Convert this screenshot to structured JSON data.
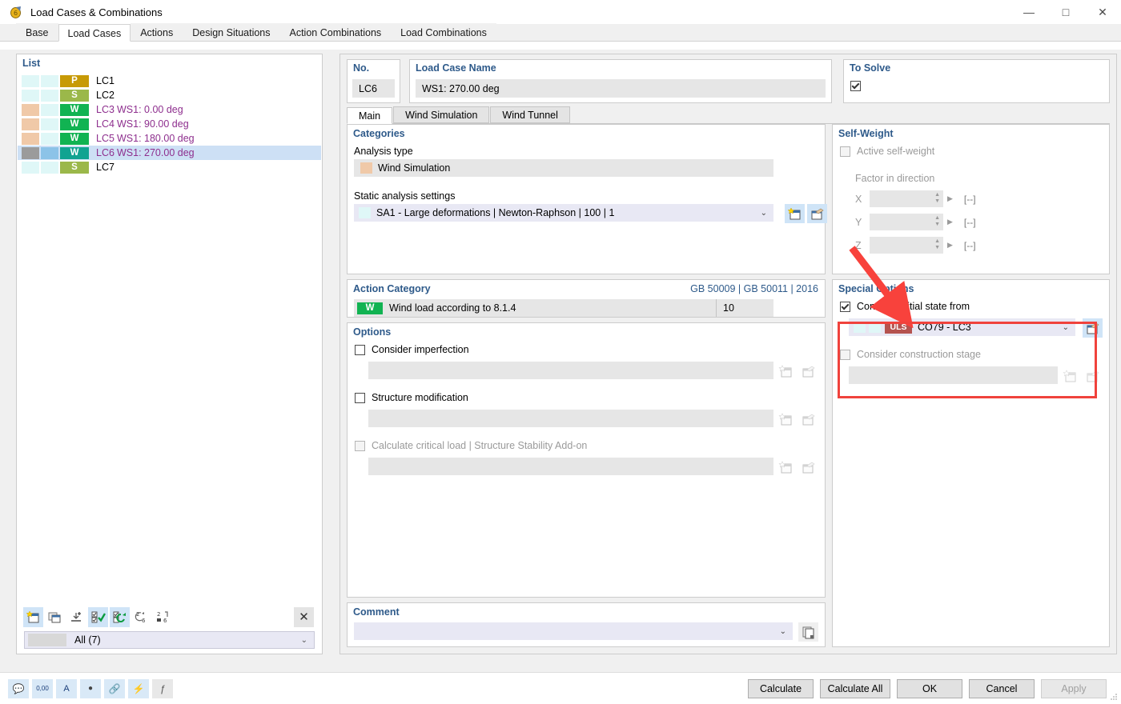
{
  "window": {
    "title": "Load Cases & Combinations",
    "icon": "app-icon",
    "minimize": "—",
    "maximize": "□",
    "close": "✕"
  },
  "tabs": [
    {
      "label": "Base",
      "active": false
    },
    {
      "label": "Load Cases",
      "active": true
    },
    {
      "label": "Actions",
      "active": false
    },
    {
      "label": "Design Situations",
      "active": false
    },
    {
      "label": "Action Combinations",
      "active": false
    },
    {
      "label": "Load Combinations",
      "active": false
    }
  ],
  "list": {
    "title": "List",
    "rows": [
      {
        "sw1": "#dff7f7",
        "sw2": "#dff7f7",
        "badge": "P",
        "badge_color": "#c79a06",
        "no": "LC1",
        "desc": "",
        "selected": false
      },
      {
        "sw1": "#dff7f7",
        "sw2": "#dff7f7",
        "badge": "S",
        "badge_color": "#9bb84a",
        "no": "LC2",
        "desc": "",
        "selected": false
      },
      {
        "sw1": "#f0c9a8",
        "sw2": "#dff7f7",
        "badge": "W",
        "badge_color": "#11b352",
        "no": "LC3",
        "desc": "WS1: 0.00 deg",
        "selected": false
      },
      {
        "sw1": "#f0c9a8",
        "sw2": "#dff7f7",
        "badge": "W",
        "badge_color": "#11b352",
        "no": "LC4",
        "desc": "WS1: 90.00 deg",
        "selected": false
      },
      {
        "sw1": "#f0c9a8",
        "sw2": "#dff7f7",
        "badge": "W",
        "badge_color": "#11b352",
        "no": "LC5",
        "desc": "WS1: 180.00 deg",
        "selected": false
      },
      {
        "sw1": "#9b9b9b",
        "sw2": "#8cc3e8",
        "badge": "W",
        "badge_color": "#11a391",
        "no": "LC6",
        "desc": "WS1: 270.00 deg",
        "selected": true
      },
      {
        "sw1": "#dff7f7",
        "sw2": "#dff7f7",
        "badge": "S",
        "badge_color": "#9bb84a",
        "no": "LC7",
        "desc": "",
        "selected": false
      }
    ],
    "toolbar": [
      {
        "name": "new-load-case-button",
        "highlight": true
      },
      {
        "name": "copy-load-case-button",
        "highlight": false
      },
      {
        "name": "import-load-case-button",
        "highlight": false
      },
      {
        "name": "select-all-button",
        "highlight": true
      },
      {
        "name": "invert-selection-button",
        "highlight": true
      },
      {
        "name": "renumber-button",
        "highlight": false
      },
      {
        "name": "sort-button",
        "highlight": false
      }
    ],
    "close_icon": "✕",
    "filter": {
      "label": "All (7)",
      "caret": "⌄"
    }
  },
  "header": {
    "no": {
      "title": "No.",
      "value": "LC6"
    },
    "name": {
      "title": "Load Case Name",
      "value": "WS1: 270.00 deg"
    },
    "to_solve": {
      "title": "To Solve",
      "checked": true
    }
  },
  "inner_tabs": [
    {
      "label": "Main",
      "active": true
    },
    {
      "label": "Wind Simulation",
      "active": false
    },
    {
      "label": "Wind Tunnel",
      "active": false
    }
  ],
  "categories": {
    "title": "Categories",
    "analysis_type_label": "Analysis type",
    "analysis_type_value": "Wind Simulation",
    "analysis_type_color": "#f0c9a8",
    "static_settings_label": "Static analysis settings",
    "static_settings_value": "SA1 - Large deformations | Newton-Raphson | 100 | 1",
    "static_settings_color": "#dff7f7",
    "caret": "⌄",
    "new_icon": "new-icon",
    "edit_icon": "edit-icon"
  },
  "action_category": {
    "title": "Action Category",
    "standard": "GB 50009 | GB 50011 | 2016",
    "badge": "W",
    "badge_color": "#11b352",
    "value": "Wind load according to 8.1.4",
    "number": "10"
  },
  "options": {
    "title": "Options",
    "items": [
      {
        "label": "Consider imperfection",
        "checked": false,
        "disabled": false,
        "value": ""
      },
      {
        "label": "Structure modification",
        "checked": false,
        "disabled": false,
        "value": ""
      },
      {
        "label": "Calculate critical load | Structure Stability Add-on",
        "checked": false,
        "disabled": true,
        "value": ""
      }
    ]
  },
  "comment": {
    "title": "Comment",
    "value": "",
    "caret": "⌄",
    "copy_icon": "copy-icon"
  },
  "self_weight": {
    "title": "Self-Weight",
    "active_label": "Active self-weight",
    "active_checked": false,
    "factor_label": "Factor in direction",
    "axes": [
      {
        "label": "X",
        "value": "",
        "unit": "[--]"
      },
      {
        "label": "Y",
        "value": "",
        "unit": "[--]"
      },
      {
        "label": "Z",
        "value": "",
        "unit": "[--]"
      }
    ]
  },
  "special_options": {
    "title": "Special Options",
    "initial_state": {
      "label": "Consider initial state from",
      "checked": true,
      "sw1": "#dff7f7",
      "sw2": "#dff7f7",
      "badge": "ULS",
      "badge_color": "#b5534f",
      "value": "CO79 - LC3",
      "caret": "⌄",
      "edit_icon": "edit-icon"
    },
    "construction_stage": {
      "label": "Consider construction stage",
      "checked": false,
      "disabled": true,
      "value": ""
    },
    "highlight_color": "#f0423c"
  },
  "annotation": {
    "arrow_color": "#f8423c",
    "name": "red-arrow-annotation"
  },
  "status_bar": {
    "icons": [
      {
        "name": "info-icon",
        "glyph": "💬",
        "style": "blue"
      },
      {
        "name": "numeric-icon",
        "glyph": "0,00",
        "style": "blue"
      },
      {
        "name": "color-label-icon",
        "glyph": "A",
        "style": "blue"
      },
      {
        "name": "point-icon",
        "glyph": "●",
        "style": "blue"
      },
      {
        "name": "link-icon",
        "glyph": "🔗",
        "style": "blue"
      },
      {
        "name": "snap-icon",
        "glyph": "⚡",
        "style": "blue"
      },
      {
        "name": "formula-icon",
        "glyph": "ƒ",
        "style": "plain"
      }
    ]
  },
  "dialog_buttons": [
    {
      "label": "Calculate",
      "disabled": false
    },
    {
      "label": "Calculate All",
      "disabled": false
    },
    {
      "label": "OK",
      "disabled": false
    },
    {
      "label": "Cancel",
      "disabled": false
    },
    {
      "label": "Apply",
      "disabled": true
    }
  ]
}
